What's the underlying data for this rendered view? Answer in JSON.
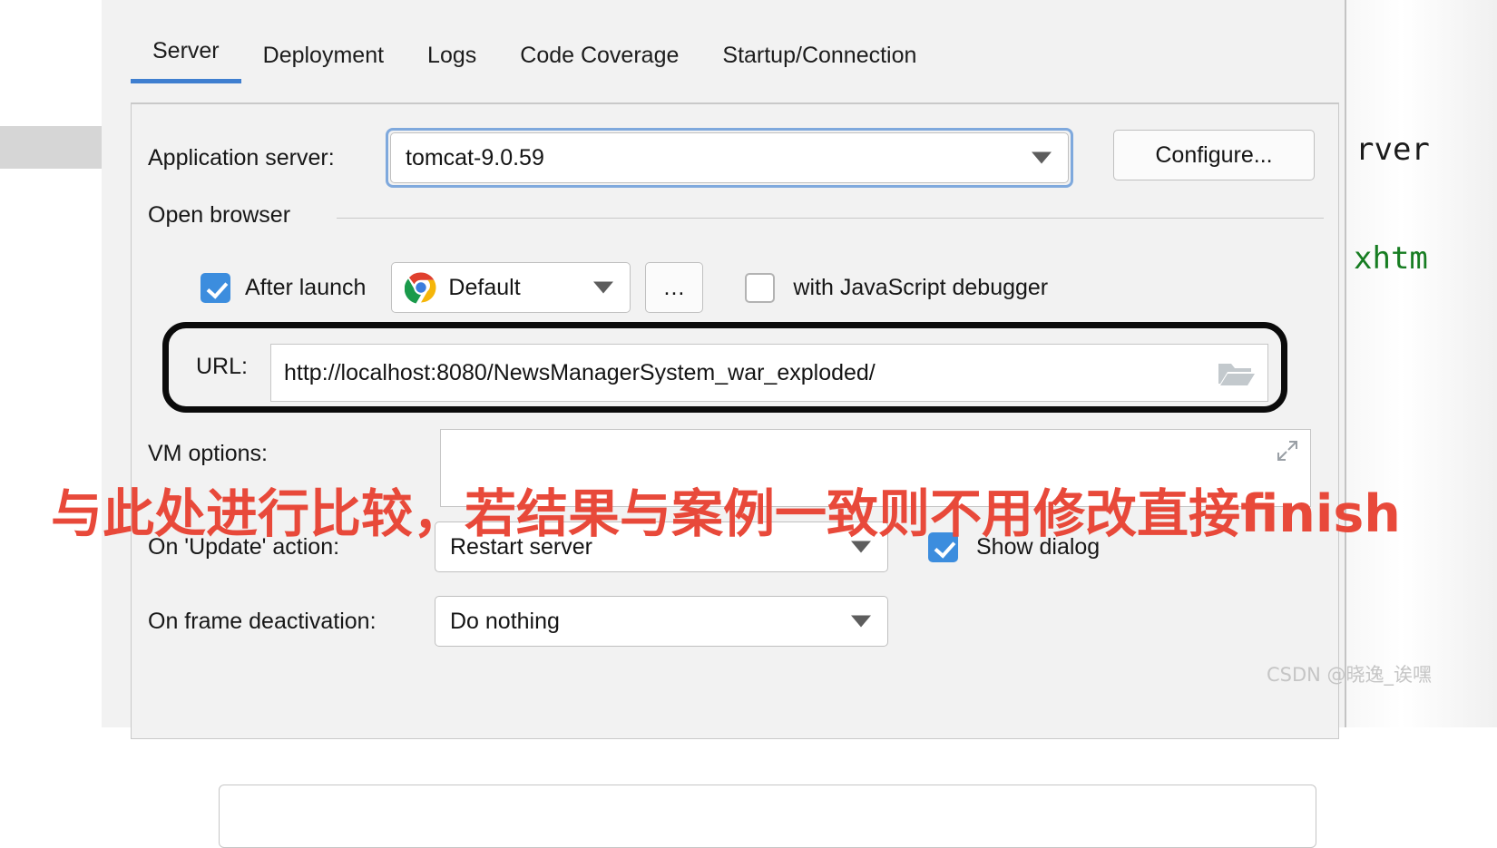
{
  "background_editor": {
    "code_line_1": "rver",
    "code_line_2": "xhtm"
  },
  "dialog": {
    "tabs": [
      {
        "label": "Server",
        "active": true
      },
      {
        "label": "Deployment",
        "active": false
      },
      {
        "label": "Logs",
        "active": false
      },
      {
        "label": "Code Coverage",
        "active": false
      },
      {
        "label": "Startup/Connection",
        "active": false
      }
    ],
    "application_server": {
      "label": "Application server:",
      "value": "tomcat-9.0.59",
      "configure_button": "Configure..."
    },
    "open_browser": {
      "group_title": "Open browser",
      "after_launch_label": "After launch",
      "after_launch_checked": true,
      "browser_value": "Default",
      "browser_icon": "chrome-icon",
      "ellipsis_button": "...",
      "js_debugger_label": "with JavaScript debugger",
      "js_debugger_checked": false,
      "url_label": "URL:",
      "url_value": "http://localhost:8080/NewsManagerSystem_war_exploded/"
    },
    "vm_options": {
      "label": "VM options:",
      "value": ""
    },
    "on_update_action": {
      "label": "On 'Update' action:",
      "value": "Restart server",
      "show_dialog_label": "Show dialog",
      "show_dialog_checked": true
    },
    "on_frame_deactivation": {
      "label": "On frame deactivation:",
      "value": "Do nothing"
    }
  },
  "annotation": {
    "red_note": "与此处进行比较，若结果与案例一致则不用修改直接finish"
  },
  "watermark": {
    "text": "CSDN @晓逸_诶嘿"
  },
  "colors": {
    "accent_blue": "#3f7fd0",
    "checkbox_blue": "#3c8dde",
    "annotation_red": "#e8493a",
    "panel_bg": "#f2f2f2",
    "code_green": "#177d22"
  }
}
